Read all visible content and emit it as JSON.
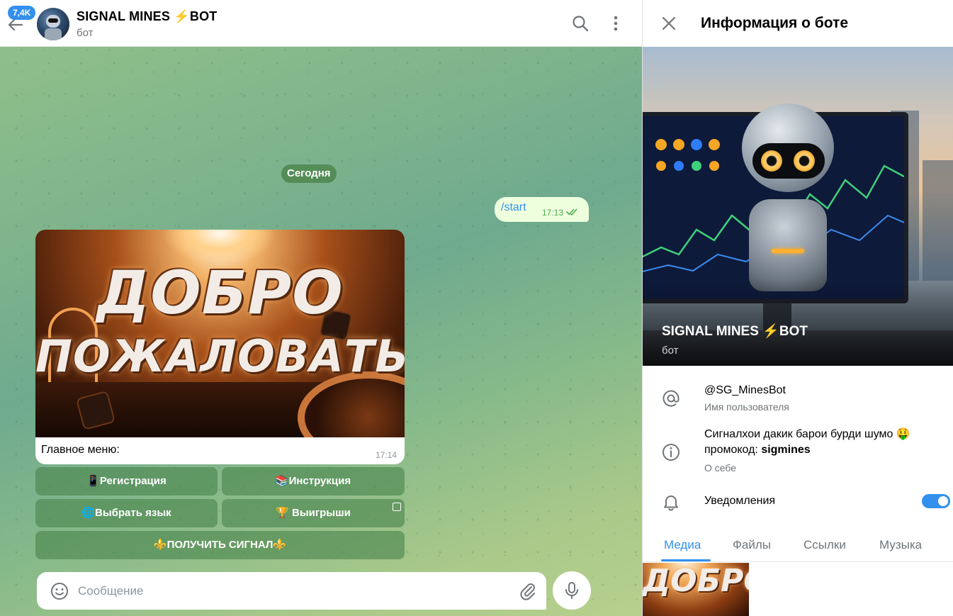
{
  "chat": {
    "unread_count": "7,4K",
    "title": "SIGNAL MINES ⚡BOT",
    "subtitle": "бот",
    "date_divider": "Сегодня",
    "outgoing": {
      "text": "/start",
      "time": "17:13"
    },
    "incoming": {
      "image_line1": "ДОБРО",
      "image_line2": "ПОЖАЛОВАТЬ",
      "caption": "Главное меню:",
      "time": "17:14"
    },
    "keyboard": [
      {
        "label": "📱Регистрация"
      },
      {
        "label": "📚Инструкция"
      },
      {
        "label": "🌐Выбрать язык"
      },
      {
        "label": "🏆 Выигрыши"
      },
      {
        "label": "⚜️ПОЛУЧИТЬ СИГНАЛ⚜️"
      }
    ],
    "composer": {
      "placeholder": "Сообщение",
      "value": ""
    }
  },
  "info": {
    "title": "Информация о боте",
    "bot_name": "SIGNAL MINES ⚡BOT",
    "bot_sub": "бот",
    "username": "@SG_MinesBot",
    "username_label": "Имя пользователя",
    "about_line1": "Сигналхои дакик барои бурди шумо 🤑",
    "about_promo_prefix": "промокод: ",
    "about_promo_code": "sigmines",
    "about_label": "О себе",
    "notifications_label": "Уведомления",
    "notifications_on": true,
    "tabs": [
      "Медиа",
      "Файлы",
      "Ссылки",
      "Музыка"
    ],
    "thumb_text": "ДОБРО"
  },
  "colors": {
    "accent": "#3390ec",
    "outgoing_bubble": "#eeffde",
    "keyboard_button": "#4a844e"
  },
  "icons": [
    "back-arrow-icon",
    "search-icon",
    "more-vertical-icon",
    "double-check-icon",
    "emoji-icon",
    "paperclip-icon",
    "microphone-icon",
    "close-icon",
    "at-sign-icon",
    "info-icon",
    "bell-icon",
    "checkbox-icon"
  ]
}
